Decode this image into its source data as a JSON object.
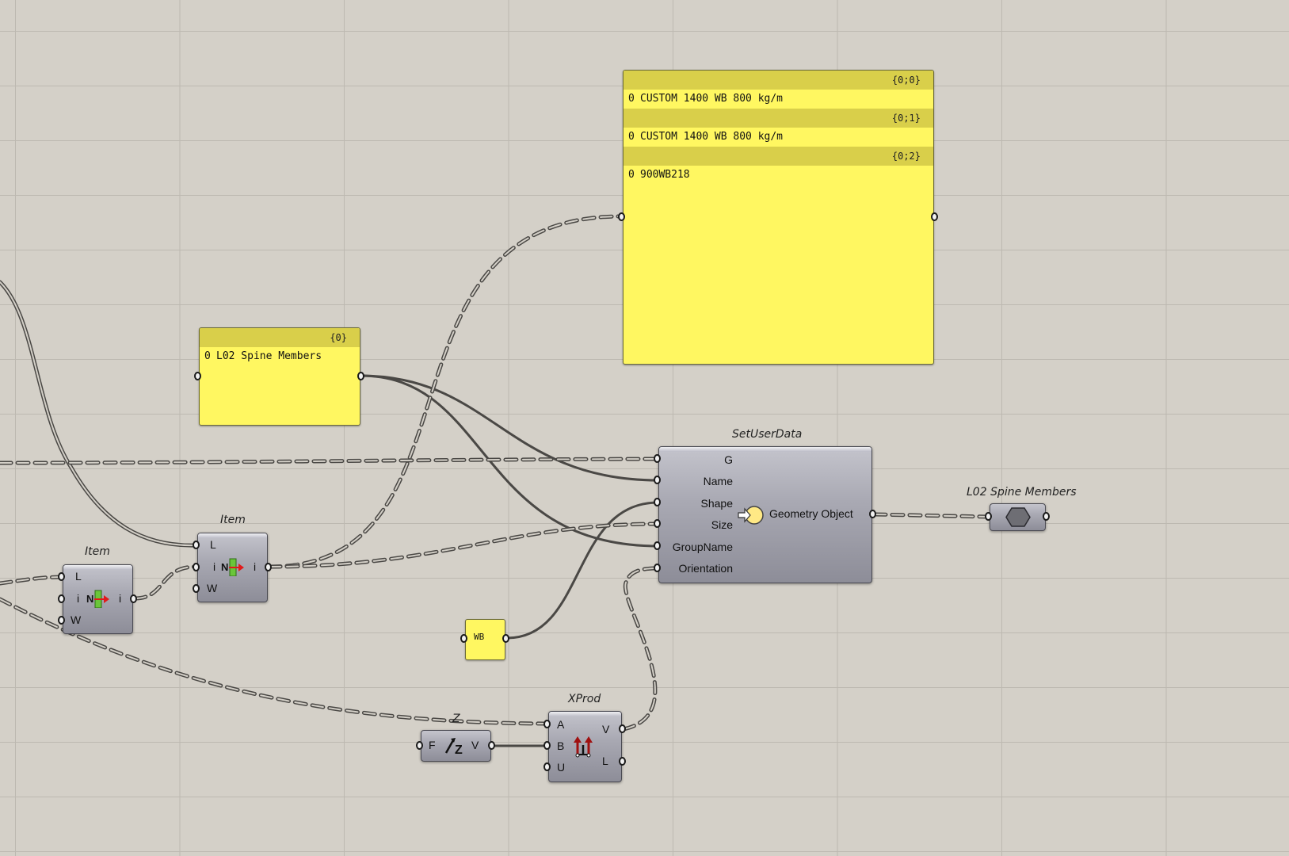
{
  "panels": {
    "spine_members": {
      "path": "{0}",
      "rows": [
        {
          "index": "0",
          "text": "L02 Spine Members"
        }
      ]
    },
    "section_names": {
      "branches": [
        {
          "path": "{0;0}",
          "index": "0",
          "text": "CUSTOM 1400 WB 800 kg/m"
        },
        {
          "path": "{0;1}",
          "index": "0",
          "text": "CUSTOM 1400 WB 800 kg/m"
        },
        {
          "path": "{0;2}",
          "index": "0",
          "text": "900WB218"
        }
      ]
    },
    "wb": {
      "text": "WB"
    }
  },
  "components": {
    "item_1": {
      "caption": "Item",
      "inputs": [
        "L",
        "i",
        "W"
      ],
      "output": "i",
      "icon": "list-item-icon"
    },
    "item_2": {
      "caption": "Item",
      "inputs": [
        "L",
        "i",
        "W"
      ],
      "output": "i",
      "icon": "list-item-icon"
    },
    "set_user_data": {
      "caption": "SetUserData",
      "inputs": [
        "G",
        "Name",
        "Shape",
        "Size",
        "GroupName",
        "Orientation"
      ],
      "output": "Geometry Object",
      "icon": "set-user-data-icon"
    },
    "geometry_param": {
      "caption": "L02 Spine Members",
      "icon": "hexagon-geometry-icon"
    },
    "unit_z": {
      "caption": "Z",
      "input": "F",
      "output": "V",
      "icon": "unit-z-icon"
    },
    "xprod": {
      "caption": "XProd",
      "inputs": [
        "A",
        "B",
        "U"
      ],
      "outputs": [
        "V",
        "L"
      ],
      "icon": "cross-product-icon"
    }
  },
  "colors": {
    "canvas": "#d4d0c8",
    "grid": "#bdb9b1",
    "panel": "#fff761",
    "panel_header": "#d9cf4a",
    "wire": "#4a4845"
  }
}
